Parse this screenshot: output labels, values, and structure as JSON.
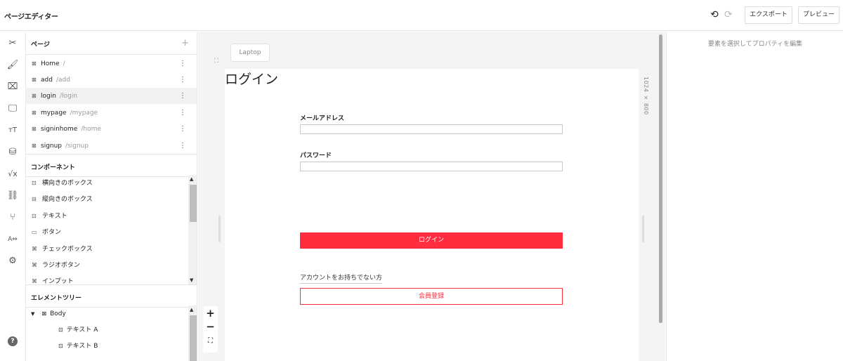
{
  "app": {
    "title": "ページエディター"
  },
  "toolbar": {
    "undo": "⟲",
    "redo": "⟳",
    "export_label": "エクスポート",
    "preview_label": "プレビュー"
  },
  "iconbar": [
    "✂",
    "🖌",
    "⌧",
    "🖵",
    "тT",
    "⛁",
    "√x",
    "⛓",
    "⑂",
    "A⇔",
    "⚙",
    "?"
  ],
  "pages": {
    "title": "ページ",
    "add": "+",
    "items": [
      {
        "name": "Home",
        "path": "/"
      },
      {
        "name": "add",
        "path": "/add"
      },
      {
        "name": "login",
        "path": "/login"
      },
      {
        "name": "mypage",
        "path": "/mypage"
      },
      {
        "name": "signinhome",
        "path": "/home"
      },
      {
        "name": "signup",
        "path": "/signup"
      }
    ]
  },
  "components": {
    "title": "コンポーネント",
    "items": [
      "横向きのボックス",
      "縦向きのボックス",
      "テキスト",
      "ボタン",
      "チェックボックス",
      "ラジオボタン",
      "インプット"
    ]
  },
  "tree": {
    "title": "エレメントツリー",
    "root": "Body",
    "children": [
      "テキスト A",
      "テキスト B"
    ]
  },
  "canvas": {
    "device": "Laptop",
    "dimensions": "1024 × 800"
  },
  "form": {
    "heading": "ログイン",
    "email_label": "メールアドレス",
    "password_label": "パスワード",
    "login_button": "ログイン",
    "no_account": "アカウントをお持ちでない方",
    "register_button": "会員登録"
  },
  "properties": {
    "hint": "要素を選択してプロパティを編集"
  },
  "colors": {
    "accent": "#ff2e3f"
  }
}
